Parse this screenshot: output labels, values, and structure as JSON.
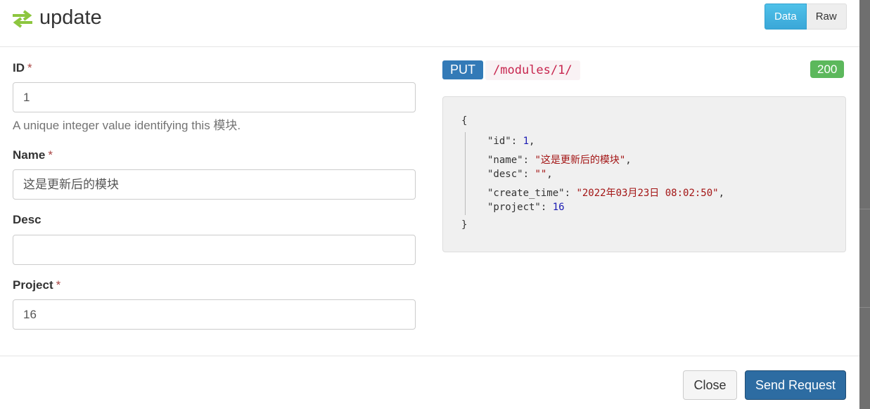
{
  "header": {
    "title": "update",
    "icon": "transfer-arrows-icon",
    "view_toggle": {
      "data_label": "Data",
      "raw_label": "Raw",
      "active": "Data"
    }
  },
  "form": {
    "id": {
      "label": "ID",
      "required_mark": "*",
      "value": "1",
      "help": "A unique integer value identifying this 模块."
    },
    "name": {
      "label": "Name",
      "required_mark": "*",
      "value": "这是更新后的模块"
    },
    "desc": {
      "label": "Desc",
      "value": ""
    },
    "project": {
      "label": "Project",
      "required_mark": "*",
      "value": "16"
    }
  },
  "request": {
    "method": "PUT",
    "path": "/modules/1/",
    "status_code": "200"
  },
  "response": {
    "open_brace": "{",
    "close_brace": "}",
    "fields": [
      {
        "key": "\"id\"",
        "value": "1",
        "type": "number"
      },
      {
        "key": "\"name\"",
        "value": "\"这是更新后的模块\"",
        "type": "string"
      },
      {
        "key": "\"desc\"",
        "value": "\"\"",
        "type": "string"
      },
      {
        "key": "\"create_time\"",
        "value": "\"2022年03月23日 08:02:50\"",
        "type": "string"
      },
      {
        "key": "\"project\"",
        "value": "16",
        "type": "number"
      }
    ]
  },
  "footer": {
    "close_label": "Close",
    "send_label": "Send Request"
  },
  "colors": {
    "accent_green": "#8dc63f",
    "method_blue": "#337ab7",
    "status_green": "#5cb85c",
    "primary_button": "#2d6ca2"
  }
}
